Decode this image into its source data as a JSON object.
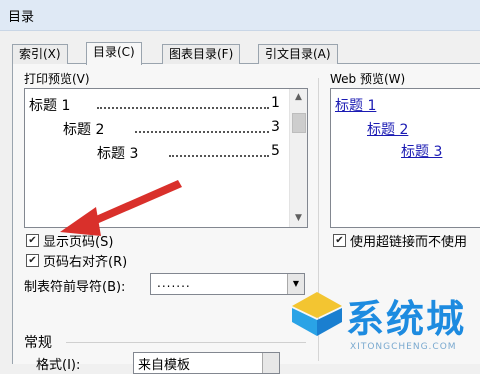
{
  "dialog": {
    "title": "目录"
  },
  "tabs": [
    {
      "label": "索引(X)",
      "active": false
    },
    {
      "label": "目录(C)",
      "active": true
    },
    {
      "label": "图表目录(F)",
      "active": false
    },
    {
      "label": "引文目录(A)",
      "active": false
    }
  ],
  "print_preview": {
    "label": "打印预览(V)",
    "entries": [
      {
        "text": "标题 1",
        "page": "1"
      },
      {
        "text": "标题 2",
        "page": "3"
      },
      {
        "text": "标题 3",
        "page": "5"
      }
    ]
  },
  "web_preview": {
    "label": "Web 预览(W)",
    "links": [
      "标题 1",
      "标题 2",
      "标题 3"
    ]
  },
  "options": {
    "show_page_numbers": {
      "label": "显示页码(S)",
      "checked": true
    },
    "right_align_page_numbers": {
      "label": "页码右对齐(R)",
      "checked": true
    },
    "tab_leader": {
      "label": "制表符前导符(B):",
      "value": "......."
    },
    "use_hyperlinks": {
      "label": "使用超链接而不使用",
      "checked": true
    }
  },
  "general": {
    "heading": "常规",
    "format_label": "格式(I):",
    "format_value": "来自模板"
  },
  "colors": {
    "accent_arrow": "#d9302b",
    "link": "#1b1bb3",
    "watermark": "#1d8be0"
  },
  "watermark": {
    "text": "系统城",
    "subtext": "XITONGCHENG.COM"
  }
}
